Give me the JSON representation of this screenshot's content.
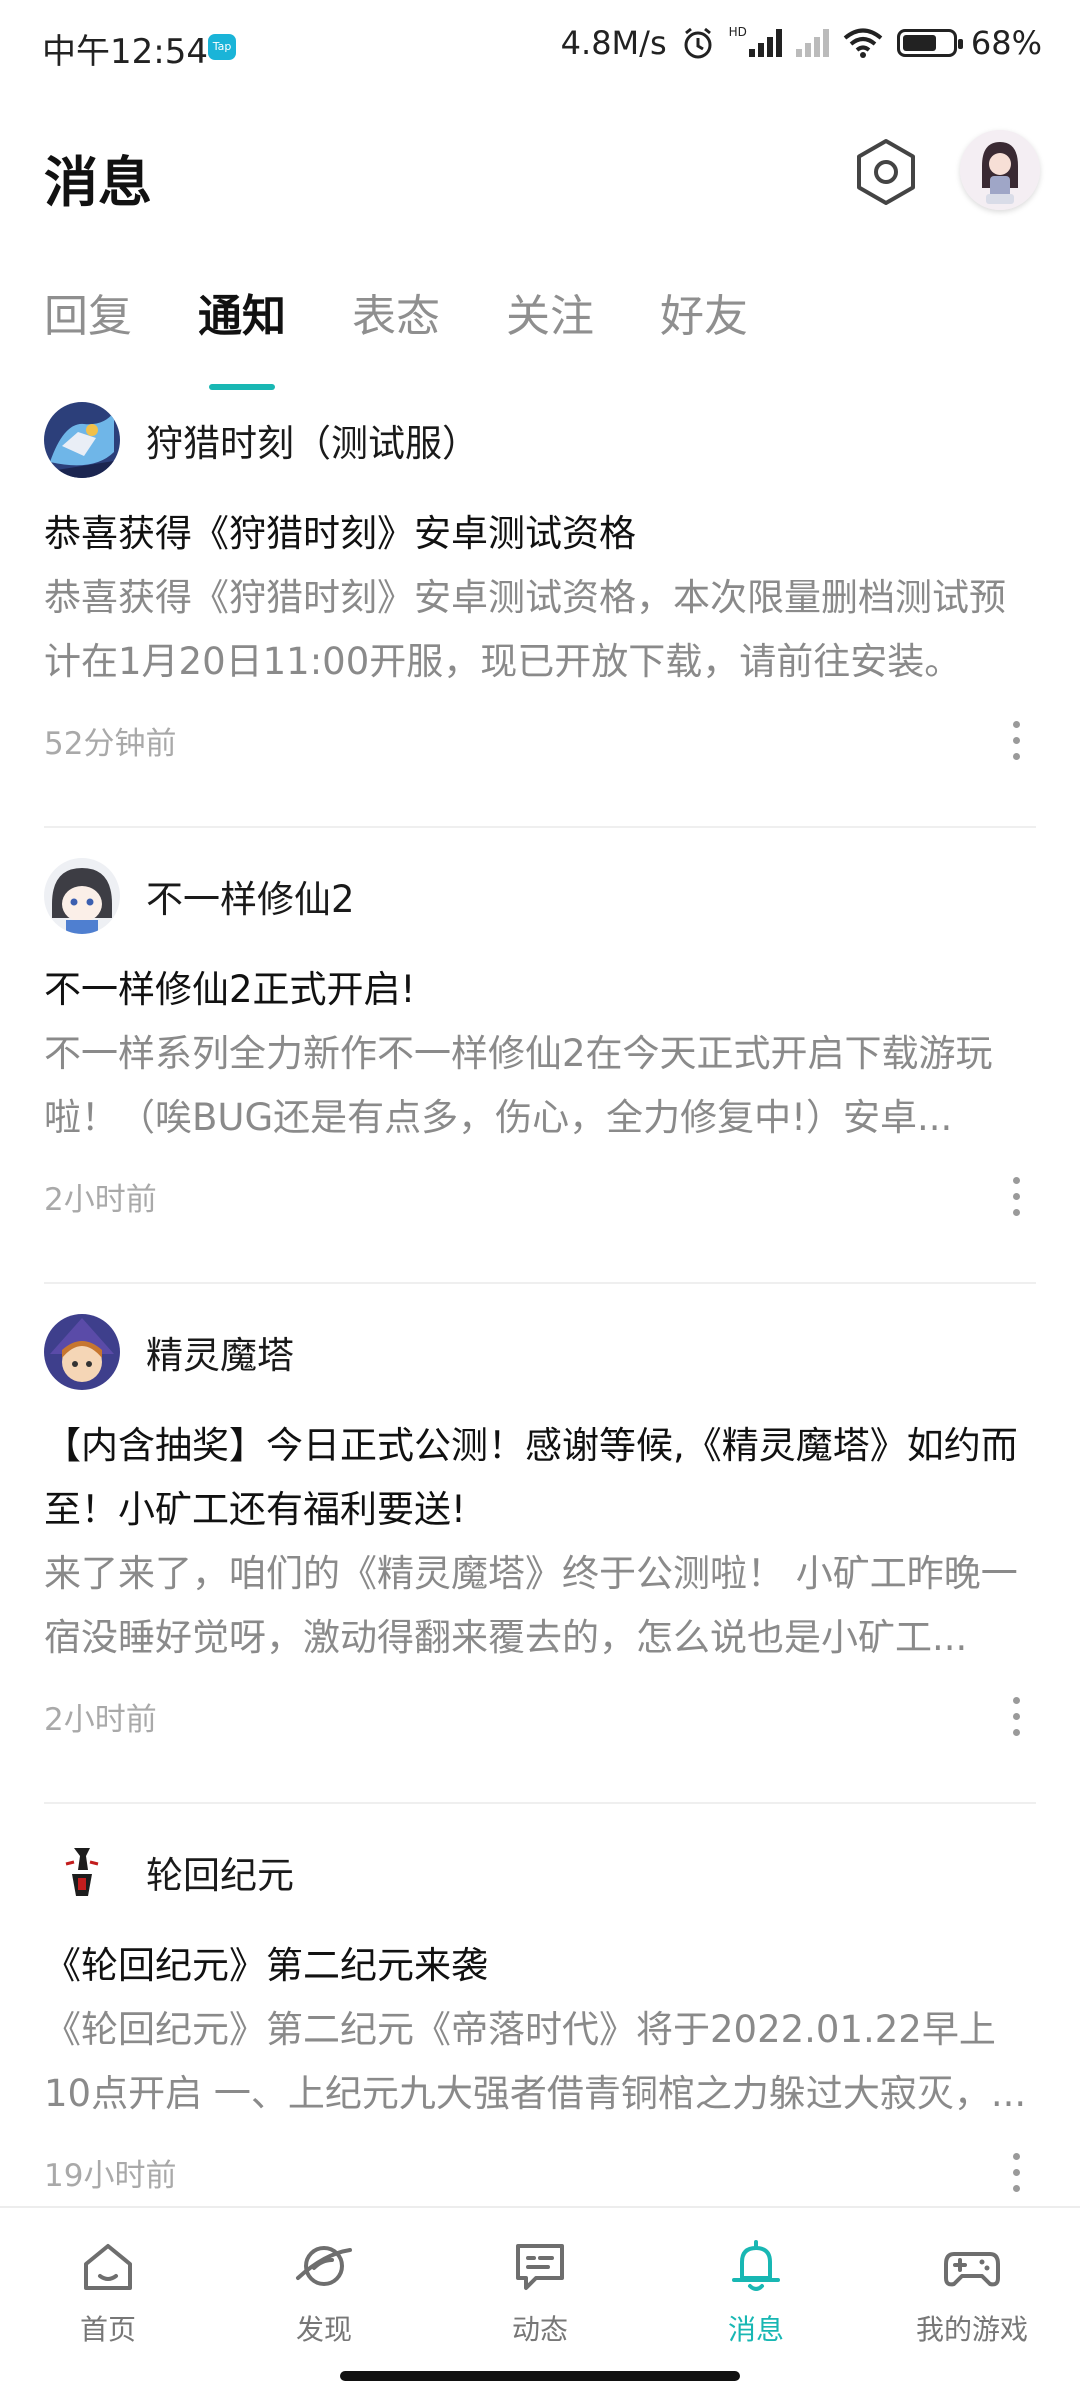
{
  "status_bar": {
    "time": "中午12:54",
    "app_badge": "Tap",
    "network_speed": "4.8M/s",
    "hd": "HD",
    "battery_text": "68%",
    "battery_level": 0.68
  },
  "header": {
    "title": "消息"
  },
  "tabs": [
    {
      "label": "回复",
      "active": false
    },
    {
      "label": "通知",
      "active": true
    },
    {
      "label": "表态",
      "active": false
    },
    {
      "label": "关注",
      "active": false
    },
    {
      "label": "好友",
      "active": false
    }
  ],
  "notifications": [
    {
      "source": "狩猎时刻（测试服）",
      "title": "恭喜获得《狩猎时刻》安卓测试资格",
      "body": "恭喜获得《狩猎时刻》安卓测试资格，本次限量删档测试预计在1月20日11:00开服，现已开放下载，请前往安装。",
      "time": "52分钟前"
    },
    {
      "source": "不一样修仙2",
      "title": "不一样修仙2正式开启!",
      "body": "不一样系列全力新作不一样修仙2在今天正式开启下载游玩啦！（唉BUG还是有点多，伤心，全力修复中!）安卓...",
      "time": "2小时前"
    },
    {
      "source": "精灵魔塔",
      "title": "【内含抽奖】今日正式公测！感谢等候,《精灵魔塔》如约而至！小矿工还有福利要送!",
      "body": "来了来了，咱们的《精灵魔塔》终于公测啦！ 小矿工昨晚一宿没睡好觉呀，激动得翻来覆去的，怎么说也是小矿工...",
      "time": "2小时前"
    },
    {
      "source": "轮回纪元",
      "title": "《轮回纪元》第二纪元来袭",
      "body": "《轮回纪元》第二纪元《帝落时代》将于2022.01.22早上10点开启 一、上纪元九大强者借青铜棺之力躲过大寂灭，...",
      "time": "19小时前"
    }
  ],
  "bottom_nav": [
    {
      "label": "首页",
      "icon": "home-icon",
      "active": false
    },
    {
      "label": "发现",
      "icon": "discover-planet-icon",
      "active": false
    },
    {
      "label": "动态",
      "icon": "chat-feed-icon",
      "active": false
    },
    {
      "label": "消息",
      "icon": "bell-icon",
      "active": true
    },
    {
      "label": "我的游戏",
      "icon": "gamepad-icon",
      "active": false
    }
  ],
  "colors": {
    "accent": "#18b7b3",
    "muted_text": "#8a8a8a",
    "time_text": "#a9a9a9"
  }
}
